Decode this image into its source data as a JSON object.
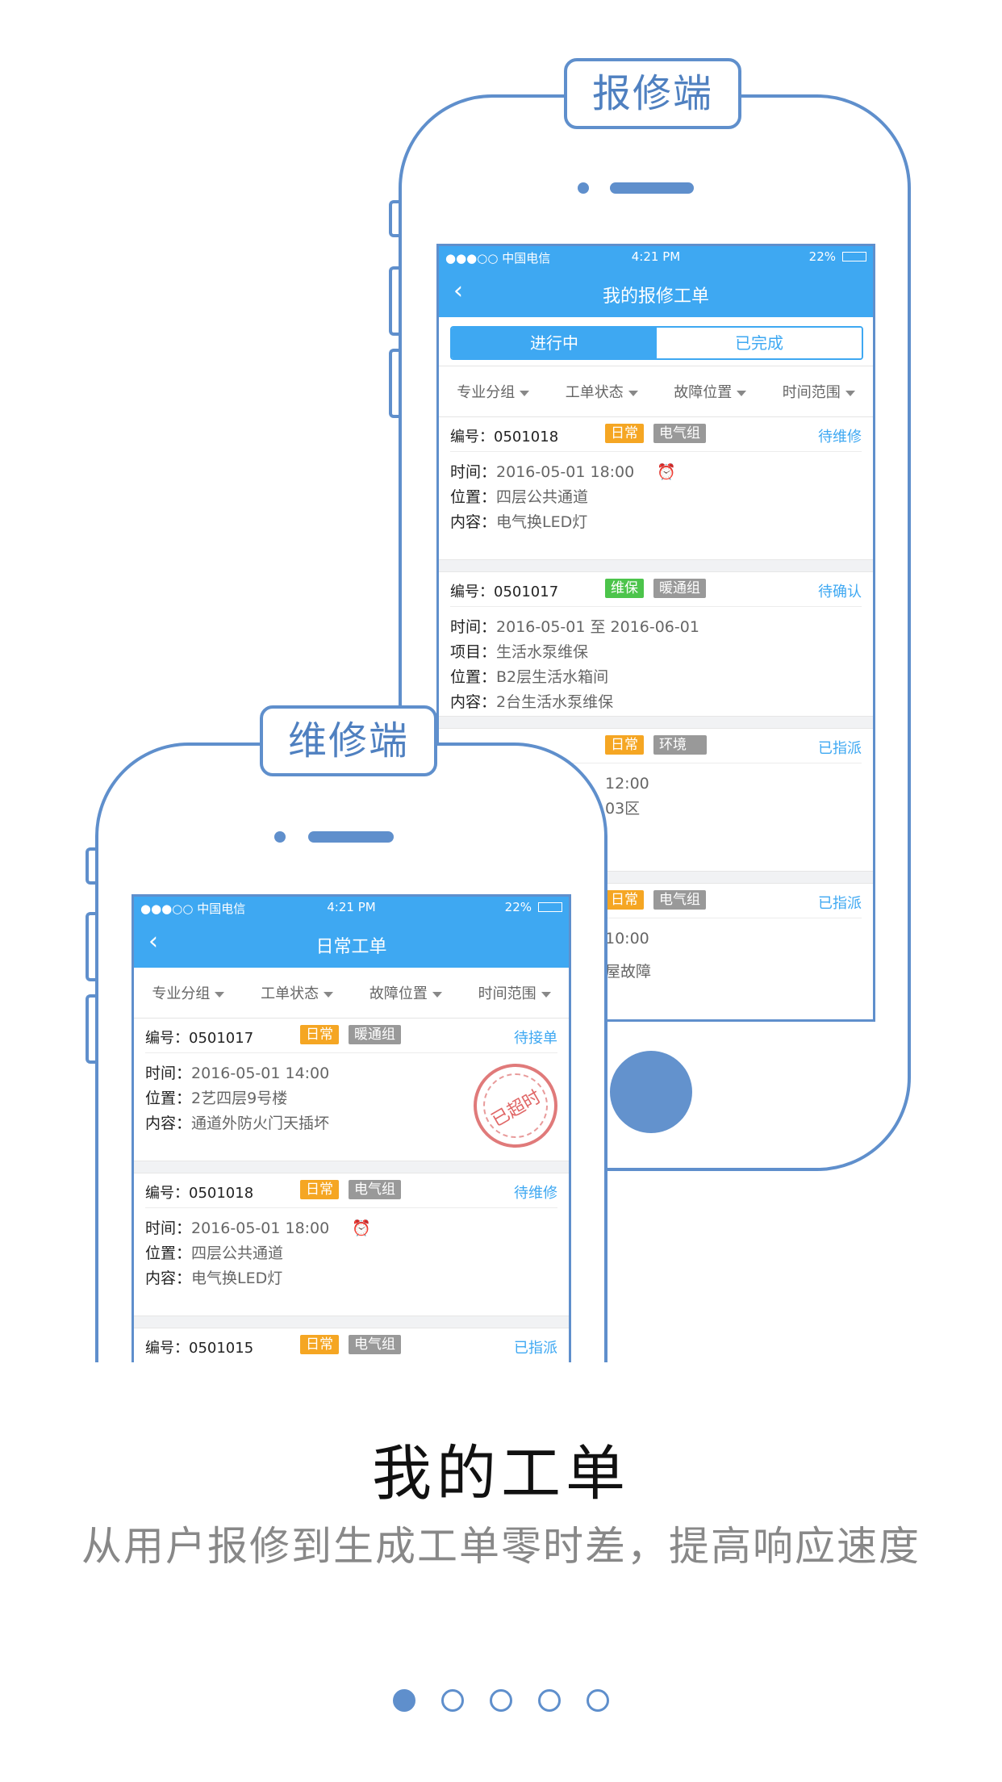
{
  "colors": {
    "brand": "#3ea8f2",
    "frame": "#5f8fcc",
    "tag_orange": "#f5a623",
    "tag_green": "#4cc44b",
    "tag_gray": "#999999"
  },
  "repair_phone": {
    "badge": "报修端",
    "status": {
      "carrier": "●●●○○ 中国电信",
      "time": "4:21 PM",
      "battery": "22%"
    },
    "nav_title": "我的报修工单",
    "tabs": [
      "进行中",
      "已完成"
    ],
    "filters": [
      "专业分组",
      "工单状态",
      "故障位置",
      "时间范围"
    ],
    "cards": [
      {
        "no": "编号：0501018",
        "tag1": "日常",
        "tag2": "电气组",
        "status": "待维修",
        "rows": [
          {
            "k": "时间：",
            "v": "2016-05-01  18:00"
          },
          {
            "k": "位置：",
            "v": "四层公共通道"
          },
          {
            "k": "内容：",
            "v": "电气换LED灯"
          }
        ]
      },
      {
        "no": "编号：0501017",
        "tag1": "维保",
        "tag2": "暖通组",
        "status": "待确认",
        "rows": [
          {
            "k": "时间：",
            "v": "2016-05-01  至  2016-06-01"
          },
          {
            "k": "项目：",
            "v": "生活水泵维保"
          },
          {
            "k": "位置：",
            "v": "B2层生活水箱间"
          },
          {
            "k": "内容：",
            "v": "2台生活水泵维保"
          }
        ]
      },
      {
        "no": "",
        "tag1": "日常",
        "tag2": "环境",
        "status": "已指派",
        "rows": [
          {
            "k": "",
            "v": "12:00"
          },
          {
            "k": "",
            "v": "03区"
          }
        ]
      },
      {
        "no": "",
        "tag1": "日常",
        "tag2": "电气组",
        "status": "已指派",
        "rows": [
          {
            "k": "",
            "v": "10:00"
          },
          {
            "k": "",
            "v": "屋故障"
          }
        ]
      }
    ]
  },
  "maintain_phone": {
    "badge": "维修端",
    "status": {
      "carrier": "●●●○○ 中国电信",
      "time": "4:21 PM",
      "battery": "22%"
    },
    "nav_title": "日常工单",
    "filters": [
      "专业分组",
      "工单状态",
      "故障位置",
      "时间范围"
    ],
    "cards": [
      {
        "no": "编号：0501017",
        "tag1": "日常",
        "tag2": "暖通组",
        "status": "待接单",
        "stamp": "已超时",
        "rows": [
          {
            "k": "时间：",
            "v": "2016-05-01  14:00"
          },
          {
            "k": "位置：",
            "v": "2艺四层9号楼"
          },
          {
            "k": "内容：",
            "v": "通道外防火门天插坏"
          }
        ]
      },
      {
        "no": "编号：0501018",
        "tag1": "日常",
        "tag2": "电气组",
        "status": "待维修",
        "rows": [
          {
            "k": "时间：",
            "v": "2016-05-01  18:00"
          },
          {
            "k": "位置：",
            "v": "四层公共通道"
          },
          {
            "k": "内容：",
            "v": "电气换LED灯"
          }
        ]
      },
      {
        "no": "编号：0501015",
        "tag1": "日常",
        "tag2": "电气组",
        "status": "已指派",
        "rows": []
      }
    ]
  },
  "caption": {
    "title": "我的工单",
    "subtitle": "从用户报修到生成工单零时差，提高响应速度"
  },
  "pager": {
    "count": 5,
    "active": 1
  }
}
